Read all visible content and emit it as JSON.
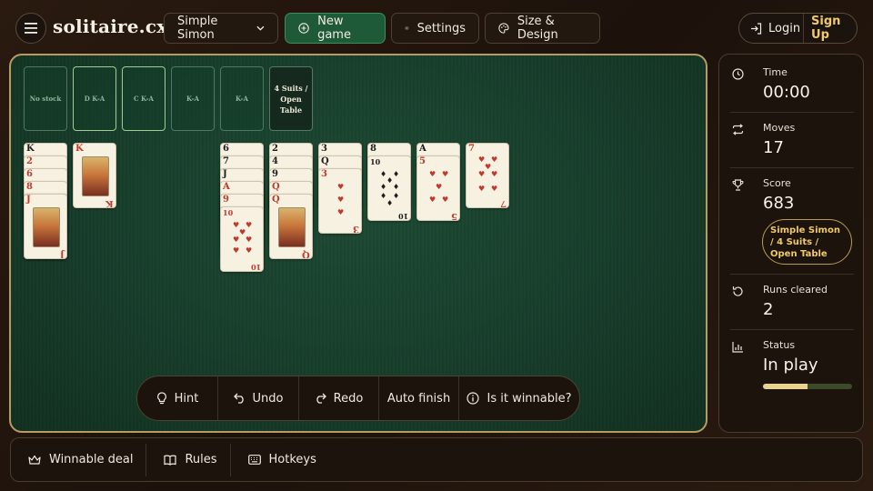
{
  "header": {
    "logo": "solitaire.cx",
    "game_select": "Simple Simon",
    "new_game": "New game",
    "settings": "Settings",
    "size_design": "Size & Design",
    "login": "Login",
    "signup": "Sign Up"
  },
  "foundations": {
    "stock": "No stock",
    "slots": [
      "D K-A",
      "C K-A",
      "K-A",
      "K-A"
    ],
    "mode": "4 Suits / Open Table"
  },
  "tableau": {
    "col1": [
      "K",
      "2",
      "6",
      "8",
      "J",
      "J"
    ],
    "col2": [
      "K"
    ],
    "col5": [
      "6",
      "7",
      "J",
      "A",
      "9",
      "10"
    ],
    "col6": [
      "2",
      "4",
      "9",
      "Q",
      "Q"
    ],
    "col7": [
      "3",
      "Q",
      "3"
    ],
    "col8": [
      "8",
      "10"
    ],
    "col9": [
      "A",
      "5"
    ],
    "col10": [
      "7"
    ]
  },
  "actions": {
    "hint": "Hint",
    "undo": "Undo",
    "redo": "Redo",
    "auto_finish": "Auto finish",
    "winnable": "Is it winnable?"
  },
  "stats": {
    "time_label": "Time",
    "time": "00:00",
    "moves_label": "Moves",
    "moves": "17",
    "score_label": "Score",
    "score": "683",
    "mode_tag": "Simple Simon / 4 Suits / Open Table",
    "runs_label": "Runs cleared",
    "runs": "2",
    "status_label": "Status",
    "status": "In play",
    "progress": 0.5
  },
  "footer": {
    "winnable_deal": "Winnable deal",
    "rules": "Rules",
    "hotkeys": "Hotkeys"
  },
  "colors": {
    "accent": "#f0c96a",
    "felt": "#1d4a34",
    "new_game_green": "#1e5a37",
    "card_red": "#c0392b"
  }
}
